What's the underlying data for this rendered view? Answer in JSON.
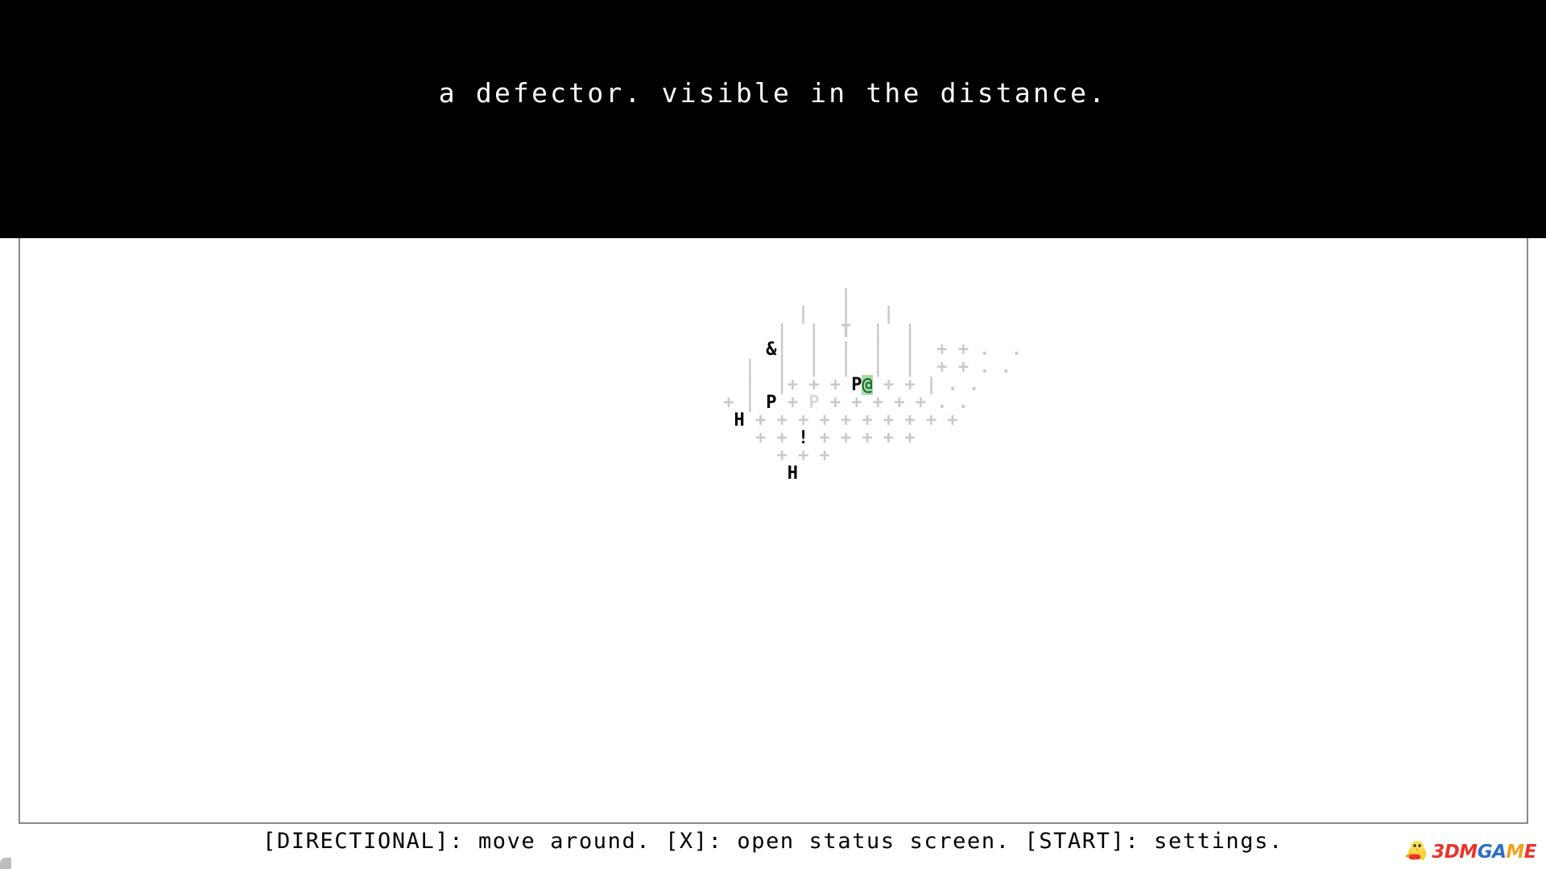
{
  "narration": {
    "text": "a defector. visible in the distance."
  },
  "controls": {
    "text": "[DIRECTIONAL]: move around. [X]: open status screen. [START]: settings."
  },
  "colors": {
    "banner_background": "#000000",
    "banner_text": "#ffffff",
    "page_background": "#ffffff",
    "frame_border": "#8a8a8a",
    "terrain_dim": "#c9c9c9",
    "terrain_faint": "#d8d8d8",
    "entity_text": "#000000",
    "player_highlight_background": "#a8dca8",
    "player_glyph": "#1d6b28",
    "controls_text": "#000000"
  },
  "map": {
    "legend": {
      "player_glyph": "@",
      "tree_glyph": "|",
      "ground_glyph": "+",
      "distant_glyph": ".",
      "person_glyph": "P",
      "house_glyph": "H",
      "alert_glyph": "!",
      "defector_glyph": "&",
      "pillar_glyph": "T"
    },
    "rows": [
      [
        {
          "t": "            ",
          "c": "g-dim"
        },
        {
          "t": "|",
          "c": "g-dim"
        }
      ],
      [
        {
          "t": "        ",
          "c": "g-dim"
        },
        {
          "t": "|",
          "c": "g-dim"
        },
        {
          "t": "   ",
          "c": "g-dim"
        },
        {
          "t": "|",
          "c": "g-dim"
        },
        {
          "t": "   ",
          "c": "g-dim"
        },
        {
          "t": "|",
          "c": "g-dim"
        }
      ],
      [
        {
          "t": "      ",
          "c": "g-dim"
        },
        {
          "t": "|",
          "c": "g-dim"
        },
        {
          "t": "  ",
          "c": "g-dim"
        },
        {
          "t": "|",
          "c": "g-dim"
        },
        {
          "t": "  ",
          "c": "g-dim"
        },
        {
          "t": "T",
          "c": "g-dim"
        },
        {
          "t": "  ",
          "c": "g-dim"
        },
        {
          "t": "|",
          "c": "g-dim"
        },
        {
          "t": "  ",
          "c": "g-dim"
        },
        {
          "t": "|",
          "c": "g-dim"
        }
      ],
      [
        {
          "t": "     ",
          "c": "g-dim"
        },
        {
          "t": "&",
          "c": "g-entity"
        },
        {
          "t": "|",
          "c": "g-dim"
        },
        {
          "t": "  ",
          "c": "g-dim"
        },
        {
          "t": "|",
          "c": "g-dim"
        },
        {
          "t": "  ",
          "c": "g-dim"
        },
        {
          "t": "|",
          "c": "g-dim"
        },
        {
          "t": "  ",
          "c": "g-dim"
        },
        {
          "t": "|",
          "c": "g-dim"
        },
        {
          "t": "  ",
          "c": "g-dim"
        },
        {
          "t": "|",
          "c": "g-dim"
        },
        {
          "t": "  ",
          "c": "g-dim"
        },
        {
          "t": "+ + .  .",
          "c": "g-dim"
        }
      ],
      [
        {
          "t": "   ",
          "c": "g-dim"
        },
        {
          "t": "|",
          "c": "g-dim"
        },
        {
          "t": "  ",
          "c": "g-dim"
        },
        {
          "t": "|",
          "c": "g-dim"
        },
        {
          "t": "  ",
          "c": "g-dim"
        },
        {
          "t": "|",
          "c": "g-dim"
        },
        {
          "t": "  ",
          "c": "g-dim"
        },
        {
          "t": "|",
          "c": "g-dim"
        },
        {
          "t": "  ",
          "c": "g-dim"
        },
        {
          "t": "|",
          "c": "g-dim"
        },
        {
          "t": "  ",
          "c": "g-dim"
        },
        {
          "t": "|",
          "c": "g-dim"
        },
        {
          "t": "  ",
          "c": "g-dim"
        },
        {
          "t": "+ + . .",
          "c": "g-dim"
        }
      ],
      [
        {
          "t": "   ",
          "c": "g-dim"
        },
        {
          "t": "|",
          "c": "g-dim"
        },
        {
          "t": "  ",
          "c": "g-dim"
        },
        {
          "t": "|",
          "c": "g-dim"
        },
        {
          "t": "+ + + ",
          "c": "g-dim"
        },
        {
          "t": "P",
          "c": "g-entity"
        },
        {
          "t": "",
          "c": "g-dim"
        },
        {
          "t": "@",
          "c": "g-player"
        },
        {
          "t": " + + ",
          "c": "g-dim"
        },
        {
          "t": "|",
          "c": "g-dim"
        },
        {
          "t": " . .",
          "c": "g-dim"
        }
      ],
      [
        {
          "t": " + ",
          "c": "g-dim"
        },
        {
          "t": "|",
          "c": "g-dim"
        },
        {
          "t": " ",
          "c": "g-dim"
        },
        {
          "t": "P",
          "c": "g-entity"
        },
        {
          "t": " + ",
          "c": "g-dim"
        },
        {
          "t": "P",
          "c": "g-faint"
        },
        {
          "t": " + + + + + . .",
          "c": "g-dim"
        }
      ],
      [
        {
          "t": "  ",
          "c": "g-dim"
        },
        {
          "t": "H",
          "c": "g-entity"
        },
        {
          "t": " + + + + + + + + + +",
          "c": "g-dim"
        }
      ],
      [
        {
          "t": "    + + ",
          "c": "g-dim"
        },
        {
          "t": "!",
          "c": "g-entity"
        },
        {
          "t": " + + + + +",
          "c": "g-dim"
        }
      ],
      [
        {
          "t": "      + + +",
          "c": "g-dim"
        }
      ],
      [
        {
          "t": "       ",
          "c": "g-dim"
        },
        {
          "t": "H",
          "c": "g-entity"
        }
      ]
    ]
  },
  "watermark": {
    "text_3": "3",
    "text_d": "D",
    "text_m": "M",
    "text_g": "G",
    "text_a": "A",
    "text_m2": "M",
    "text_e": "E"
  }
}
